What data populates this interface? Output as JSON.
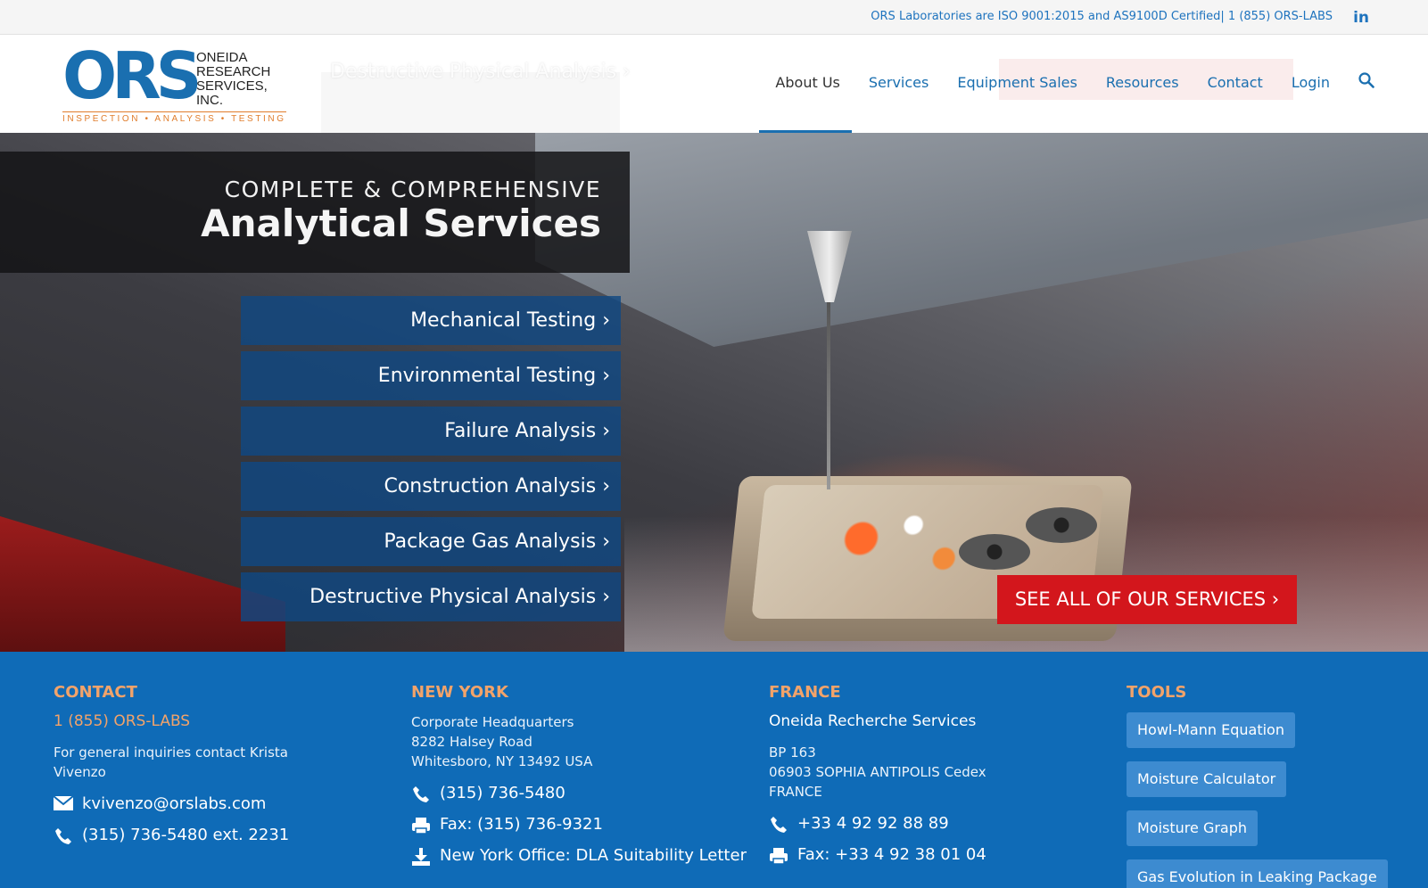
{
  "topbar": {
    "text": "ORS Laboratories are ISO 9001:2015 and AS9100D Certified| 1 (855) ORS-LABS",
    "linkedin_glyph": "in"
  },
  "logo": {
    "mark": "ORS",
    "name_line1": "ONEIDA",
    "name_line2": "RESEARCH",
    "name_line3": "SERVICES, INC.",
    "tagline": "INSPECTION • ANALYSIS • TESTING"
  },
  "nav": {
    "items": [
      {
        "label": "About Us",
        "active": true
      },
      {
        "label": "Services"
      },
      {
        "label": "Equipment Sales"
      },
      {
        "label": "Resources"
      },
      {
        "label": "Contact"
      },
      {
        "label": "Login"
      }
    ],
    "search_icon": "search-icon",
    "ghost_text": "Destructive Physical Analysis ›"
  },
  "hero": {
    "kicker": "COMPLETE & COMPREHENSIVE",
    "title": "Analytical Services",
    "services": [
      "Mechanical Testing ›",
      "Environmental Testing ›",
      "Failure Analysis ›",
      "Construction Analysis ›",
      "Package Gas Analysis ›",
      "Destructive Physical Analysis ›"
    ],
    "cta": "SEE ALL OF OUR SERVICES ›"
  },
  "footer": {
    "contact": {
      "title": "CONTACT",
      "phone_main": "1 (855) ORS-LABS",
      "inquiries": "For general inquiries contact Krista Vivenzo",
      "email": "kvivenzo@orslabs.com",
      "phone_ext": "(315) 736-5480 ext. 2231"
    },
    "new_york": {
      "title": "NEW YORK",
      "addr1": "Corporate Headquarters",
      "addr2": "8282 Halsey Road",
      "addr3": "Whitesboro, NY 13492 USA",
      "phone": "(315) 736-5480",
      "fax": "Fax: (315) 736-9321",
      "download": "New York Office: DLA Suitability Letter"
    },
    "france": {
      "title": "FRANCE",
      "name": "Oneida Recherche Services",
      "addr1": "BP 163",
      "addr2": "06903 SOPHIA ANTIPOLIS Cedex",
      "addr3": "FRANCE",
      "phone": "+33 4 92 92 88 89",
      "fax": "Fax: +33 4 92 38 01 04"
    },
    "tools": {
      "title": "TOOLS",
      "items": [
        "Howl-Mann Equation",
        "Moisture Calculator",
        "Moisture Graph",
        "Gas Evolution in Leaking Package"
      ]
    }
  },
  "colors": {
    "brand_blue": "#1a6fb0",
    "footer_blue": "#0f6bb7",
    "accent_orange": "#f2a36a",
    "cta_red": "#d3161c"
  }
}
